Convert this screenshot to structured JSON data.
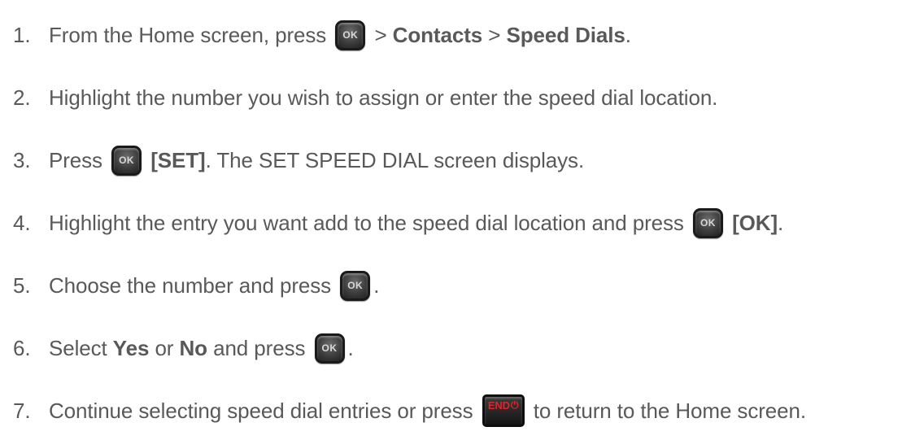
{
  "steps": [
    {
      "num": "1.",
      "parts": [
        {
          "type": "text",
          "text": "From the Home screen, press "
        },
        {
          "type": "icon",
          "icon": "ok-key-icon",
          "label": "OK"
        },
        {
          "type": "text",
          "text": " > "
        },
        {
          "type": "bold",
          "text": "Contacts"
        },
        {
          "type": "text",
          "text": " > "
        },
        {
          "type": "bold",
          "text": "Speed Dials"
        },
        {
          "type": "text",
          "text": "."
        }
      ]
    },
    {
      "num": "2.",
      "parts": [
        {
          "type": "text",
          "text": "Highlight the number you wish to assign or enter the speed dial location."
        }
      ]
    },
    {
      "num": "3.",
      "parts": [
        {
          "type": "text",
          "text": "Press "
        },
        {
          "type": "icon",
          "icon": "ok-key-icon",
          "label": "OK"
        },
        {
          "type": "bold",
          "text": " [SET]"
        },
        {
          "type": "text",
          "text": ". The SET SPEED DIAL screen displays."
        }
      ]
    },
    {
      "num": "4.",
      "parts": [
        {
          "type": "text",
          "text": "Highlight the entry you want add to the speed dial location and press "
        },
        {
          "type": "icon",
          "icon": "ok-key-icon",
          "label": "OK"
        },
        {
          "type": "bold",
          "text": " [OK]"
        },
        {
          "type": "text",
          "text": "."
        }
      ]
    },
    {
      "num": "5.",
      "parts": [
        {
          "type": "text",
          "text": "Choose the number and press "
        },
        {
          "type": "icon",
          "icon": "ok-key-icon",
          "label": "OK"
        },
        {
          "type": "text",
          "text": "."
        }
      ]
    },
    {
      "num": "6.",
      "parts": [
        {
          "type": "text",
          "text": "Select "
        },
        {
          "type": "bold",
          "text": "Yes"
        },
        {
          "type": "text",
          "text": " or "
        },
        {
          "type": "bold",
          "text": "No"
        },
        {
          "type": "text",
          "text": " and press "
        },
        {
          "type": "icon",
          "icon": "ok-key-icon",
          "label": "OK"
        },
        {
          "type": "text",
          "text": "."
        }
      ]
    },
    {
      "num": "7.",
      "parts": [
        {
          "type": "text",
          "text": "Continue selecting speed dial entries or press "
        },
        {
          "type": "icon",
          "icon": "end-key-icon",
          "label": "END"
        },
        {
          "type": "text",
          "text": " to return to the Home screen."
        }
      ]
    }
  ],
  "colors": {
    "text": "#595959",
    "end_key_label": "#e0242b",
    "key_body": "#3d3d3d"
  }
}
